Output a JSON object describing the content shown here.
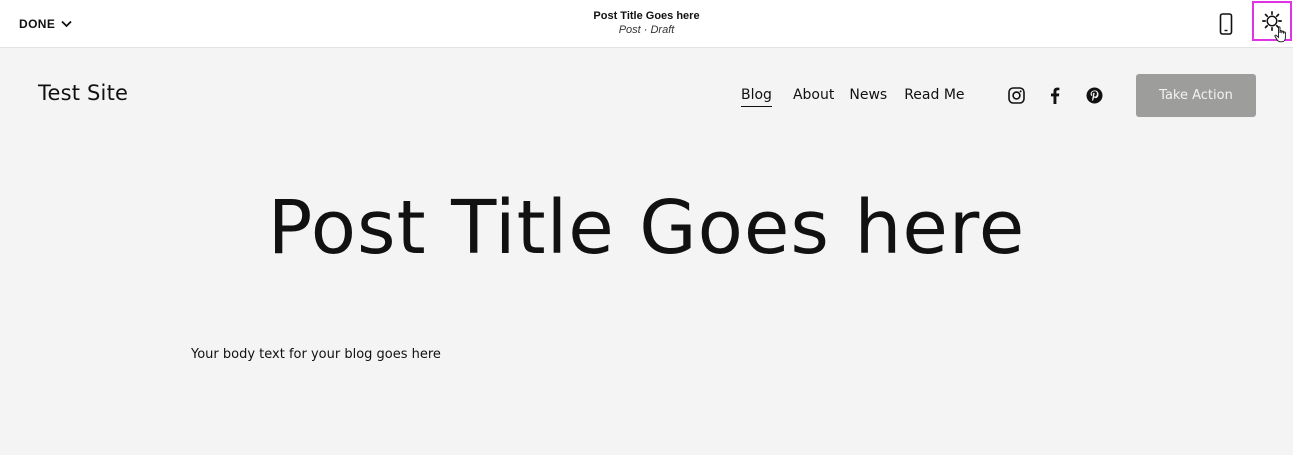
{
  "editor": {
    "done_label": "DONE",
    "post_title": "Post Title Goes here",
    "post_status": "Post · Draft",
    "icons": {
      "done_chevron": "chevron-down-icon",
      "mobile": "mobile-preview-icon",
      "settings": "gear-icon",
      "cursor": "pointer-hand-cursor-icon"
    },
    "highlight_color": "#e033e3"
  },
  "site": {
    "title": "Test Site",
    "nav": [
      {
        "label": "Blog",
        "active": true
      },
      {
        "label": "About",
        "active": false
      },
      {
        "label": "News",
        "active": false
      },
      {
        "label": "Read Me",
        "active": false
      }
    ],
    "social_icons": [
      "instagram-icon",
      "facebook-icon",
      "pinterest-icon"
    ],
    "cta_label": "Take Action",
    "cta_color": "#9d9d9b",
    "background_color": "#f4f4f4"
  },
  "post": {
    "title": "Post Title Goes here",
    "body": "Your body text for your blog goes here"
  }
}
